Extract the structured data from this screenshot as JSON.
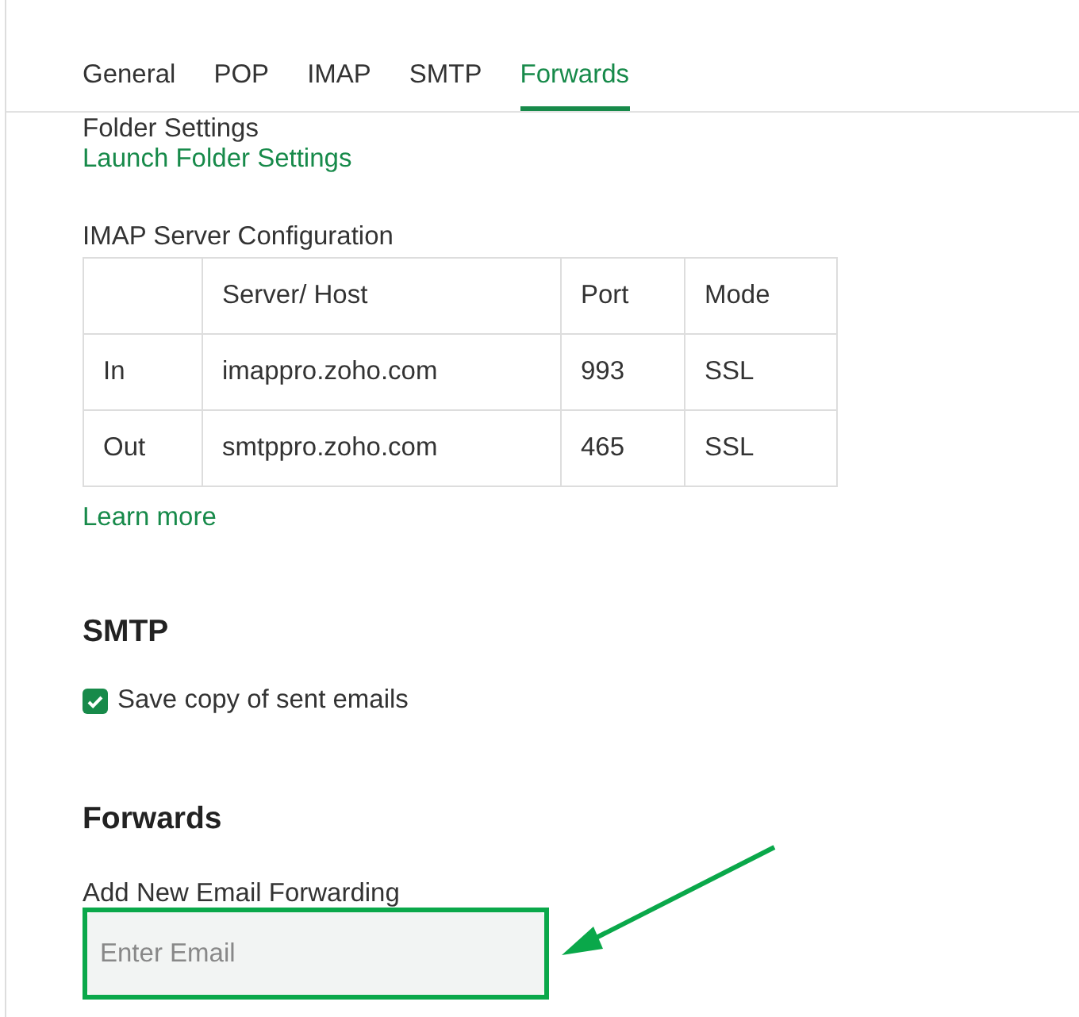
{
  "tabs": [
    {
      "label": "General",
      "selected": false
    },
    {
      "label": "POP",
      "selected": false
    },
    {
      "label": "IMAP",
      "selected": false
    },
    {
      "label": "SMTP",
      "selected": false
    },
    {
      "label": "Forwards",
      "selected": true
    }
  ],
  "folder_settings": {
    "heading": "Folder Settings",
    "link": "Launch Folder Settings"
  },
  "imap": {
    "title": "IMAP Server Configuration",
    "columns": [
      "Server/ Host",
      "Port",
      "Mode"
    ],
    "rows": [
      {
        "label": "In",
        "server": "imappro.zoho.com",
        "port": "993",
        "mode": "SSL"
      },
      {
        "label": "Out",
        "server": "smtppro.zoho.com",
        "port": "465",
        "mode": "SSL"
      }
    ],
    "link": "Learn more"
  },
  "smtp": {
    "heading": "SMTP",
    "checkbox": {
      "label": "Save copy of sent emails",
      "checked": true
    }
  },
  "forwards": {
    "heading": "Forwards",
    "field_label": "Add New Email Forwarding",
    "placeholder": "Enter Email",
    "highlighted": true
  }
}
